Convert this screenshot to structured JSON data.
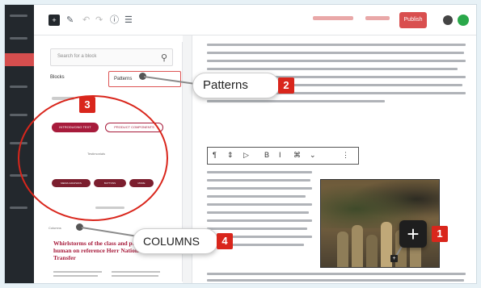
{
  "toolbar": {
    "publish_label": "Publish"
  },
  "inserter": {
    "search_placeholder": "Search for a block",
    "tab_blocks": "Blocks",
    "tab_patterns": "Patterns",
    "pattern_pill_1": "INTRODUCING TEXT",
    "pattern_pill_2": "PRODUCT COMPONENTS",
    "pattern_mid_label": "Testimonials",
    "pill_a": "MEDIA GRAPHICS",
    "pill_b": "BUTTONS",
    "pill_c": "MORE",
    "columns_label": "Columns"
  },
  "editor": {
    "heading_red": "Whirlstorms of the class and passions of the human on reference Herr Nations of Sci Transfer"
  },
  "callouts": [
    {
      "num": "1",
      "label": ""
    },
    {
      "num": "2",
      "label": "Patterns"
    },
    {
      "num": "3",
      "label": ""
    },
    {
      "num": "4",
      "label": "COLUMNS"
    }
  ],
  "colors": {
    "accent_red": "#d9261c",
    "brand_maroon": "#a71b3b",
    "dark": "#1e1e1e"
  }
}
